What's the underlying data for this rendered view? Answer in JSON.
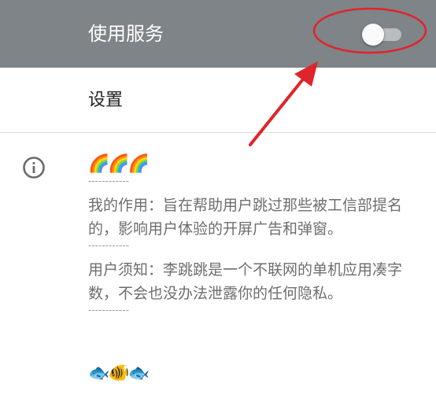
{
  "header": {
    "title": "使用服务",
    "toggle_state": "off",
    "background": "#7f8488"
  },
  "settings": {
    "label": "设置"
  },
  "about": {
    "emoji_top": "🌈🌈🌈",
    "separator": "------------",
    "purpose": "我的作用：旨在帮助用户跳过那些被工信部提名的，影响用户体验的开屏广告和弹窗。",
    "notice": "用户须知：李跳跳是一个不联网的单机应用凑字数，不会也没办法泄露你的任何隐私。",
    "emoji_bottom": "🐟🐠🐟"
  },
  "annotation": {
    "color": "#e0242b"
  }
}
